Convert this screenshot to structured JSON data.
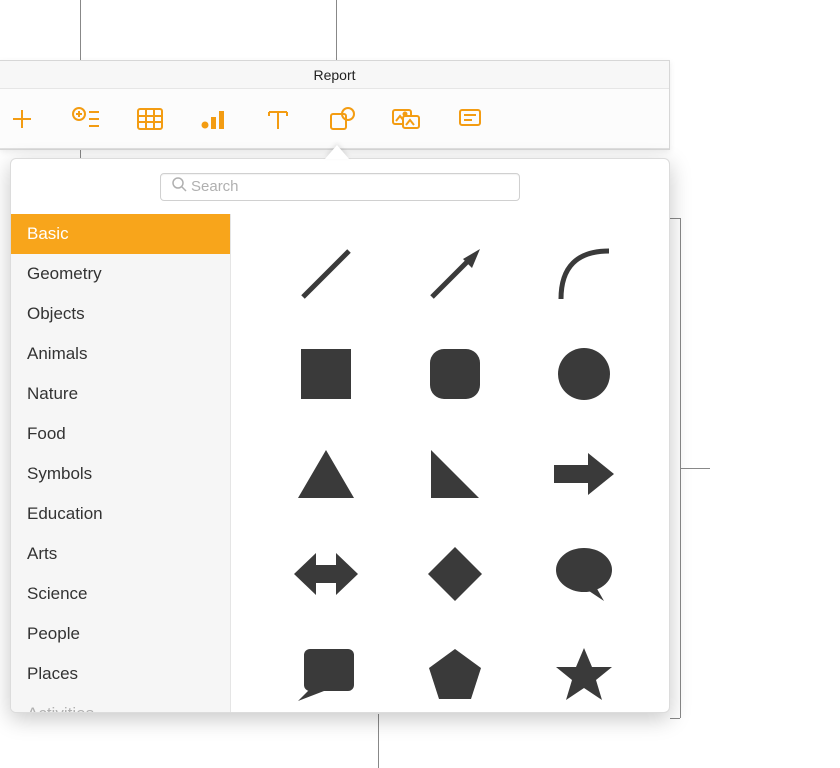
{
  "window": {
    "title": "Report"
  },
  "toolbar": {
    "items": [
      {
        "name": "insert"
      },
      {
        "name": "add-section"
      },
      {
        "name": "table"
      },
      {
        "name": "chart"
      },
      {
        "name": "text"
      },
      {
        "name": "shape"
      },
      {
        "name": "media"
      },
      {
        "name": "comment"
      }
    ]
  },
  "search": {
    "placeholder": "Search"
  },
  "categories": {
    "selected": 0,
    "items": [
      "Basic",
      "Geometry",
      "Objects",
      "Animals",
      "Nature",
      "Food",
      "Symbols",
      "Education",
      "Arts",
      "Science",
      "People",
      "Places",
      "Activities"
    ]
  },
  "shapes": [
    "line",
    "arrow-line",
    "curve",
    "square",
    "rounded-square",
    "circle",
    "triangle",
    "right-triangle",
    "right-arrow",
    "left-right-arrow",
    "diamond",
    "speech-bubble",
    "callout-square",
    "pentagon",
    "star"
  ],
  "colors": {
    "accent": "#f8a51b",
    "tool": "#f39c12",
    "shape": "#3a3a3a"
  }
}
